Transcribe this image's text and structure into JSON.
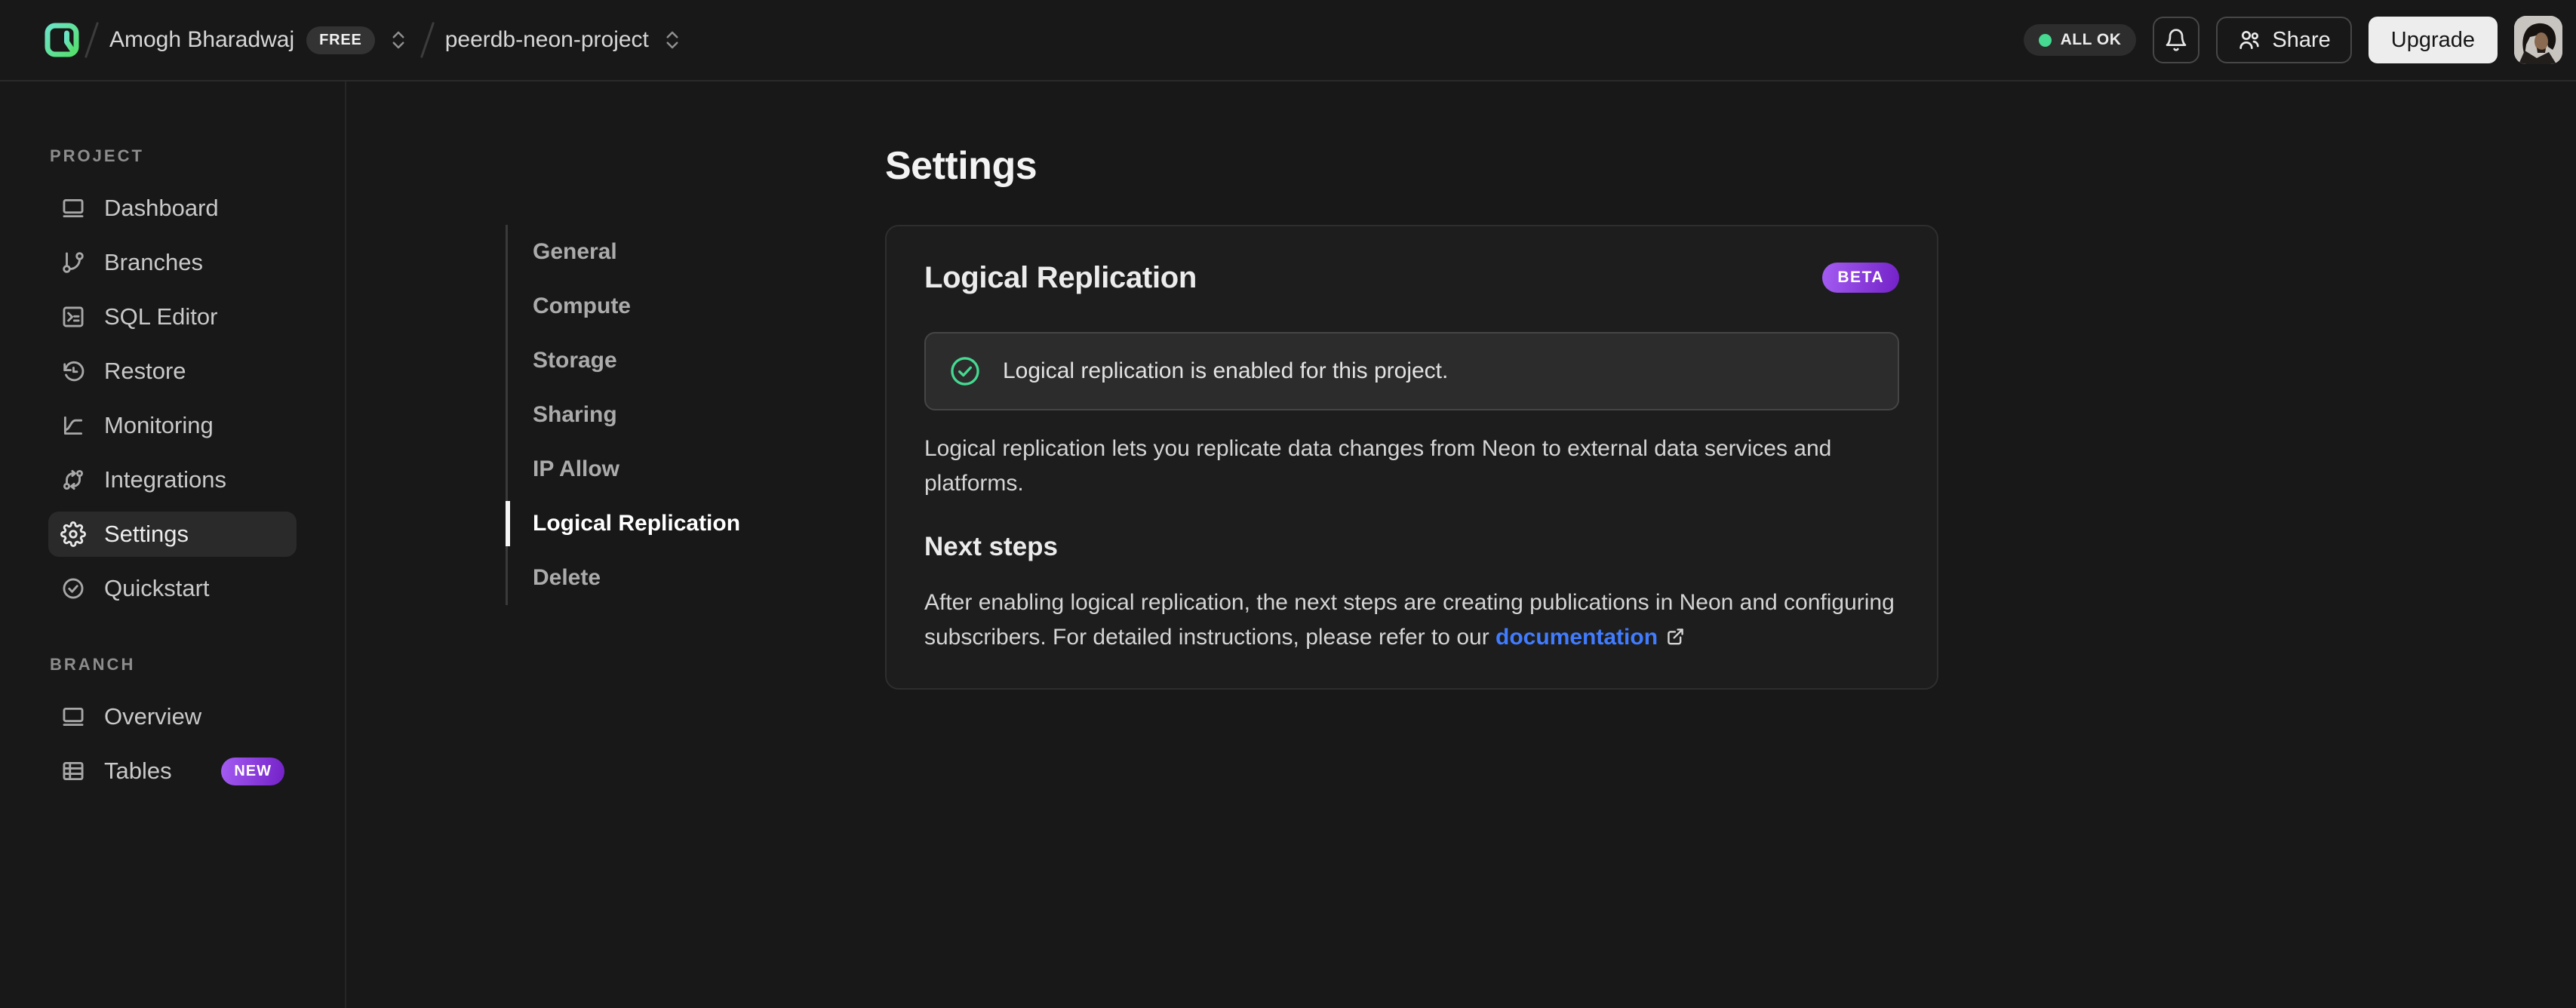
{
  "colors": {
    "page-bg": "#181818",
    "panel-bg": "#1d1d1d",
    "raised-bg": "#2c2c2c",
    "border": "#2e2e2e",
    "border-strong": "#474747",
    "text-primary": "#f0f0f0",
    "text-secondary": "#c6c6c6",
    "text-muted": "#8d8d8d",
    "accent-green": "#45d991",
    "link-blue": "#417cff",
    "badge-purple-1": "#a45df2",
    "badge-purple-2": "#7321c7",
    "brand-teal": "#6ce3c8",
    "brand-green": "#55e06d"
  },
  "header": {
    "logo": "neon-logo",
    "account": {
      "name": "Amogh Bharadwaj",
      "plan": "FREE"
    },
    "project": {
      "name": "peerdb-neon-project"
    },
    "status": {
      "label": "ALL OK"
    },
    "share": {
      "label": "Share"
    },
    "upgrade": {
      "label": "Upgrade"
    }
  },
  "sidebar": {
    "sections": [
      {
        "label": "PROJECT",
        "items": [
          {
            "label": "Dashboard",
            "icon": "browser-icon"
          },
          {
            "label": "Branches",
            "icon": "git-branch-icon"
          },
          {
            "label": "SQL Editor",
            "icon": "terminal-icon"
          },
          {
            "label": "Restore",
            "icon": "history-clock-icon"
          },
          {
            "label": "Monitoring",
            "icon": "chart-curve-icon"
          },
          {
            "label": "Integrations",
            "icon": "sync-arrows-icon"
          },
          {
            "label": "Settings",
            "icon": "gear-icon",
            "active": true
          },
          {
            "label": "Quickstart",
            "icon": "check-circle-icon"
          }
        ]
      },
      {
        "label": "BRANCH",
        "items": [
          {
            "label": "Overview",
            "icon": "browser-icon"
          },
          {
            "label": "Tables",
            "icon": "table-icon",
            "badge": "NEW"
          }
        ]
      }
    ]
  },
  "main": {
    "title": "Settings",
    "subnav": [
      "General",
      "Compute",
      "Storage",
      "Sharing",
      "IP Allow",
      "Logical Replication",
      "Delete"
    ],
    "active_subnav": "Logical Replication",
    "card": {
      "title": "Logical Replication",
      "badge": "BETA",
      "banner": {
        "text": "Logical replication is enabled for this project."
      },
      "description": "Logical replication lets you replicate data changes from Neon to external data services and platforms.",
      "next_steps": {
        "title": "Next steps",
        "text": "After enabling logical replication, the next steps are creating publications in Neon and configuring subscribers. For detailed instructions, please refer to our ",
        "link_label": "documentation"
      }
    }
  }
}
